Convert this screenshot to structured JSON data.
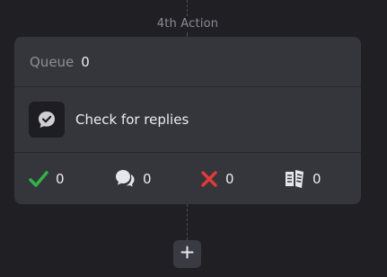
{
  "action": {
    "label": "4th Action"
  },
  "queue": {
    "label": "Queue",
    "value": "0"
  },
  "task": {
    "icon": "chat-bubble-check-icon",
    "label": "Check for replies"
  },
  "stats": [
    {
      "name": "success",
      "icon": "checkmark-icon",
      "color": "#2fb344",
      "value": "0"
    },
    {
      "name": "replied",
      "icon": "chat-bubbles-icon",
      "color": "#e6e6ea",
      "value": "0"
    },
    {
      "name": "failed",
      "icon": "x-icon",
      "color": "#e53935",
      "value": "0"
    },
    {
      "name": "other",
      "icon": "document-stack-icon",
      "color": "#e6e6ea",
      "value": "0"
    }
  ],
  "add_button": {
    "icon": "plus-icon"
  }
}
